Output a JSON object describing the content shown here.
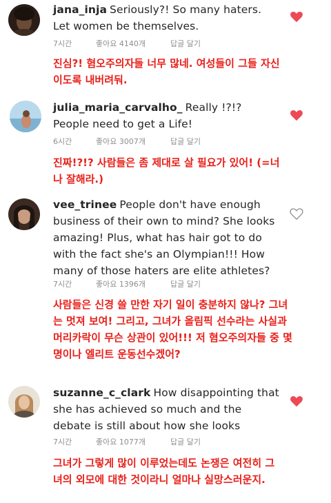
{
  "comments": [
    {
      "username": "jana_inja",
      "text": "Seriously?! So many haters. Let women be themselves.",
      "time": "7시간",
      "likes": "좋아요 4140개",
      "reply": "답글 달기",
      "liked": true,
      "translation": "진심?! 혐오주의자들 너무 많네. 여성들이 그들 자신이도록 내버려둬."
    },
    {
      "username": "julia_maria_carvalho_",
      "text": "Really !?!? People need to get a Life!",
      "time": "6시간",
      "likes": "좋아요 3007개",
      "reply": "답글 달기",
      "liked": true,
      "translation": "진짜!?!? 사람들은 좀 제대로 살 필요가 있어! (=너나 잘해라.)"
    },
    {
      "username": "vee_trinee",
      "text": "People don't have enough business of their own to mind? She looks amazing! Plus, what has hair got to do with the fact she's an Olympian!!! How many of those haters are elite athletes?",
      "time": "7시간",
      "likes": "좋아요 1396개",
      "reply": "답글 달기",
      "liked": false,
      "translation": "사람들은 신경 쓸 만한 자기 일이 충분하지 않나? 그녀는 멋져 보여! 그리고, 그녀가 올림픽 선수라는 사실과 머리카락이 무슨 상관이 있어!!! 저 혐오주의자들 중 몇 명이나 엘리트 운동선수겠어?"
    },
    {
      "username": "suzanne_c_clark",
      "text": "How disappointing that she has achieved so much and the debate is still about how she looks",
      "time": "7시간",
      "likes": "좋아요 1077개",
      "reply": "답글 달기",
      "liked": true,
      "translation": "그녀가 그렇게 많이 이루었는데도 논쟁은 여전히 그녀의 외모에 대한 것이라니 얼마나 실망스러운지."
    }
  ],
  "colors": {
    "liked_heart": "#ed4956",
    "translation_text": "#e8201a",
    "meta_text": "#8e8e8e"
  }
}
